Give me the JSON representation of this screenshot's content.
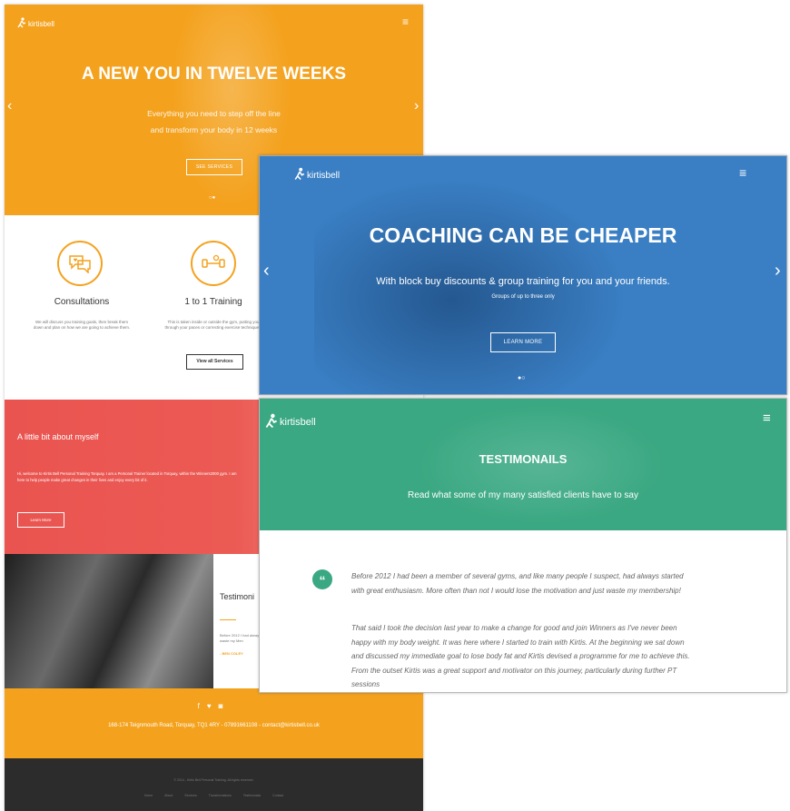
{
  "brand": {
    "logo_text": "kirtisbell",
    "menu_icon": "hamburger-icon"
  },
  "shot1": {
    "hero": {
      "title": "A NEW YOU IN TWELVE WEEKS",
      "subtitle_line1": "Everything you need to step off the line",
      "subtitle_line2": "and transform your body in 12 weeks",
      "button": "SEE SERVICES",
      "prev": "‹",
      "next": "›",
      "dots": "○●"
    },
    "services": [
      {
        "title": "Consultations",
        "desc": "We will discuss you training goals, then break them down and plan on how we are going to achieve them.",
        "icon": "chat-heart-icon"
      },
      {
        "title": "1 to 1 Training",
        "desc": "This is taken inside or outside the gym, putting you through your paces or correcting exercise techniques.",
        "icon": "dumbbell-icon"
      }
    ],
    "view_all": "View all Services",
    "about": {
      "title": "A little bit about myself",
      "desc": "Hi, welcome to Kirtis Bell Personal Training Torquay. I am a Personal Trainer located in Torquay, within the Winners2000 gym. I am here to help people make great changes in their lives and enjoy every bit of it.",
      "button": "Learn More"
    },
    "testimonial": {
      "title": "Testimoni",
      "text": "Before 2012 I had always started with just waste my Men",
      "author": "- BEN COLEY"
    },
    "footer": {
      "social": [
        "f",
        "♥",
        "◙"
      ],
      "address": "168-174 Teignmouth Road, Torquay, TQ1 4RY - 07891661108 - contact@kirtisbell.co.uk",
      "copyright": "© 2014 - Kirtis Bell Personal Training. All rights reserved.",
      "nav": [
        "Home",
        "About",
        "Services",
        "Transformations",
        "Testimonials",
        "Contact"
      ]
    }
  },
  "shot2": {
    "title": "COACHING CAN BE CHEAPER",
    "subtitle": "With block buy discounts & group training for you and your friends.",
    "note": "Groups of up to three only",
    "button": "LEARN MORE",
    "prev": "‹",
    "next": "›",
    "dots": "●○"
  },
  "shot3": {
    "title": "TESTIMONAILS",
    "subtitle": "Read what some of my many satisfied clients have to say",
    "quote_mark": "“",
    "para1": "Before 2012 I had been a member of several gyms, and like many people I suspect, had always started with great enthusiasm. More often than not I would lose the motivation and just waste my membership!",
    "para2": "That said I took the decision last year to make a change for good and join Winners as I've never been happy with my body weight. It was here where I started to train with Kirtis. At the beginning we sat down and discussed my immediate goal to lose body fat and Kirtis devised a programme for me to achieve this. From the outset Kirtis was a great support and motivator on this journey, particularly during further PT sessions"
  },
  "colors": {
    "orange": "#f4a21e",
    "blue": "#3a7fc4",
    "green": "#3aa882",
    "red": "#ea5450",
    "dark": "#2c2c2c"
  }
}
